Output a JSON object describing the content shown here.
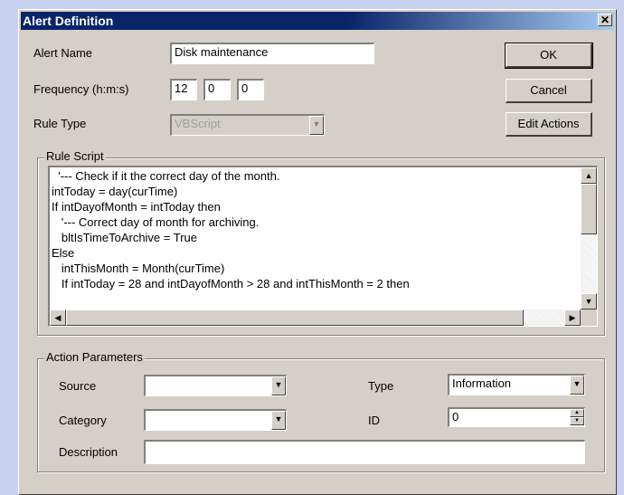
{
  "window": {
    "title": "Alert Definition"
  },
  "labels": {
    "alert_name": "Alert Name",
    "frequency": "Frequency (h:m:s)",
    "rule_type": "Rule Type",
    "rule_script": "Rule Script",
    "action_parameters": "Action Parameters",
    "source": "Source",
    "category": "Category",
    "description": "Description",
    "type": "Type",
    "id": "ID"
  },
  "fields": {
    "alert_name": "Disk maintenance",
    "freq_h": "12",
    "freq_m": "0",
    "freq_s": "0",
    "rule_type": "VBScript",
    "source": "",
    "category": "",
    "description": "",
    "type": "Information",
    "id": "0"
  },
  "buttons": {
    "ok": "OK",
    "cancel": "Cancel",
    "edit_actions": "Edit Actions"
  },
  "script_lines": [
    "  '--- Check if it the correct day of the month.",
    "intToday = day(curTime)",
    "If intDayofMonth = intToday then",
    "   '--- Correct day of month for archiving.",
    "   bltIsTimeToArchive = True",
    "Else",
    "   intThisMonth = Month(curTime)",
    "   If intToday = 28 and intDayofMonth > 28 and intThisMonth = 2 then"
  ],
  "colors": {
    "title_bar": "#0a246a",
    "face": "#d4d0c8",
    "desktop": "#c8d2f0"
  }
}
